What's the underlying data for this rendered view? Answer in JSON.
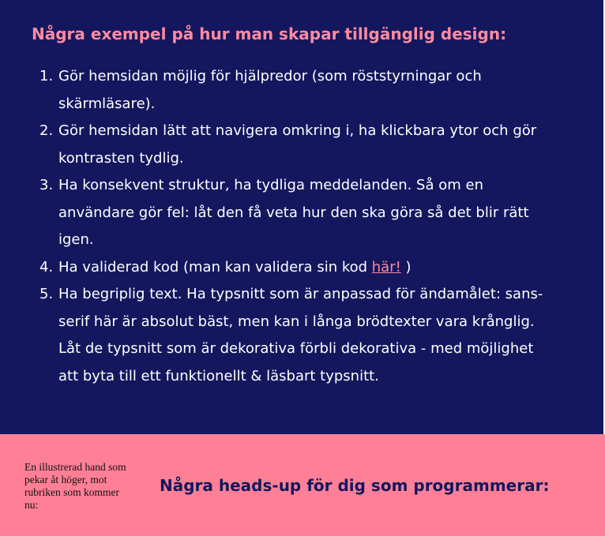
{
  "colors": {
    "navy": "#14175e",
    "pink": "#ff8096",
    "heading_pink": "#ff8ba0",
    "text_white": "#ffffff"
  },
  "section1": {
    "heading": "Några exempel på hur man skapar tillgänglig design:",
    "items": [
      {
        "number": "1.",
        "text": "Gör hemsidan möjlig för hjälpredor (som röststyrningar och skärmläsare)."
      },
      {
        "number": "2.",
        "text": "Gör hemsidan lätt att navigera omkring i, ha klickbara ytor och gör kontrasten tydlig."
      },
      {
        "number": "3.",
        "text": "Ha konsekvent struktur, ha tydliga meddelanden. Så om en användare gör fel: låt den få veta hur den ska göra så det blir rätt igen."
      },
      {
        "number": "4.",
        "text_before": "Ha validerad kod (man kan validera sin kod ",
        "link": "här!",
        "text_after": " )"
      },
      {
        "number": "5.",
        "text": "Ha begriplig text. Ha typsnitt som är anpassad för ändamålet: sans-serif här är absolut bäst, men kan i långa brödtexter vara krånglig. Låt de typsnitt som är dekorativa förbli dekorativa - med möjlighet att byta till ett funktionellt & läsbart typsnitt."
      }
    ]
  },
  "section2": {
    "image_alt": "En illustrerad hand som pekar åt höger, mot rubriken som kommer nu:",
    "heading": "Några heads-up för dig som programmerar:"
  }
}
